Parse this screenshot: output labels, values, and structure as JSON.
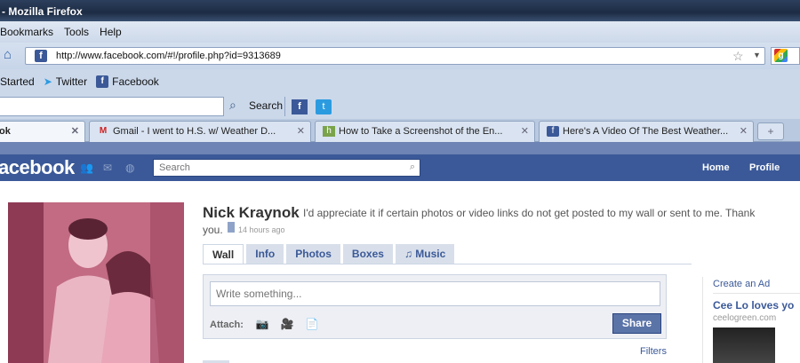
{
  "window": {
    "title": "- Mozilla Firefox"
  },
  "menu": [
    "Bookmarks",
    "Tools",
    "Help"
  ],
  "navbar": {
    "url": "http://www.facebook.com/#!/profile.php?id=9313689"
  },
  "bookmarks": [
    "Started",
    "Twitter",
    "Facebook"
  ],
  "searchbar": {
    "label": "Search"
  },
  "tabs": [
    {
      "label": "ok",
      "icon": "facebook-icon"
    },
    {
      "label": "Gmail - I went to H.S. w/ Weather D...",
      "icon": "gmail-icon"
    },
    {
      "label": "How to Take a Screenshot of the En...",
      "icon": "page-icon"
    },
    {
      "label": "Here's A Video Of The Best Weather...",
      "icon": "facebook-icon"
    }
  ],
  "facebook": {
    "logo": "acebook",
    "search_placeholder": "Search",
    "nav": [
      "Home",
      "Profile"
    ]
  },
  "profile": {
    "name": "Nick Kraynok",
    "status_line1": "I'd appreciate it if certain photos or video links do not get posted to my wall or sent to me. Thank",
    "status_line2": "you.",
    "time_ago": "14 hours ago",
    "tabs": [
      "Wall",
      "Info",
      "Photos",
      "Boxes",
      "♫ Music"
    ]
  },
  "composer": {
    "placeholder": "Write something...",
    "attach_label": "Attach:",
    "share_label": "Share",
    "filters_label": "Filters"
  },
  "sidebar_ad": {
    "create_ad": "Create an Ad",
    "title": "Cee Lo loves yo",
    "subtitle": "ceelogreen.com"
  }
}
